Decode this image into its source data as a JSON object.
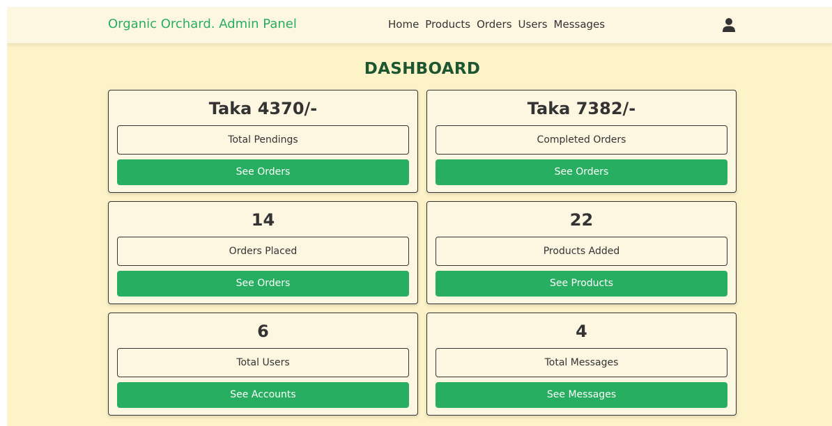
{
  "navbar": {
    "brand": "Organic Orchard. Admin Panel",
    "links": [
      "Home",
      "Products",
      "Orders",
      "Users",
      "Messages"
    ],
    "user_icon": "user-icon"
  },
  "page": {
    "title": "DASHBOARD"
  },
  "cards": [
    {
      "value": "Taka 4370/-",
      "label": "Total Pendings",
      "button": "See Orders"
    },
    {
      "value": "Taka 7382/-",
      "label": "Completed Orders",
      "button": "See Orders"
    },
    {
      "value": "14",
      "label": "Orders Placed",
      "button": "See Orders"
    },
    {
      "value": "22",
      "label": "Products Added",
      "button": "See Products"
    },
    {
      "value": "6",
      "label": "Total Users",
      "button": "See Accounts"
    },
    {
      "value": "4",
      "label": "Total Messages",
      "button": "See Messages"
    }
  ],
  "colors": {
    "page_bg": "#fdf3c9",
    "card_bg": "#fdf7e2",
    "brand": "#27ae60",
    "button": "#27ae60",
    "title": "#1e5631"
  }
}
